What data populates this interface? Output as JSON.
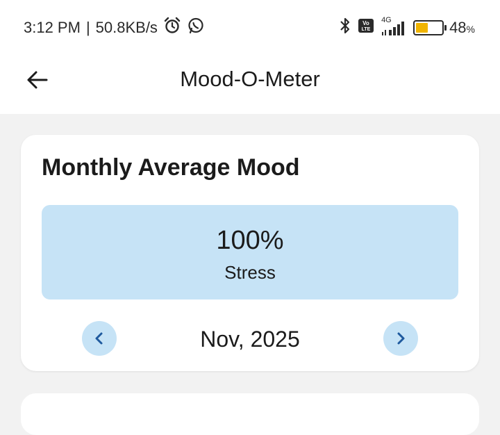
{
  "status_bar": {
    "time": "3:12 PM",
    "separator": "|",
    "speed": "50.8KB/s",
    "signal_type": "4G",
    "volte": "Vo LTE",
    "battery_percent": "48",
    "battery_unit": "%",
    "battery_level": 0.48,
    "battery_color": "#f0b400",
    "icons": [
      "alarm-icon",
      "whatsapp-icon",
      "bluetooth-icon",
      "volte-icon",
      "signal-icon",
      "battery-icon"
    ]
  },
  "app_bar": {
    "title": "Mood-O-Meter",
    "back_icon": "arrow-left-icon"
  },
  "card": {
    "title": "Monthly Average Mood",
    "mood_percent": "100%",
    "mood_label": "Stress",
    "month": "Nov, 2025",
    "prev_icon": "chevron-left-icon",
    "next_icon": "chevron-right-icon",
    "accent_color": "#c6e3f6",
    "chevron_color": "#1f5a9e"
  }
}
